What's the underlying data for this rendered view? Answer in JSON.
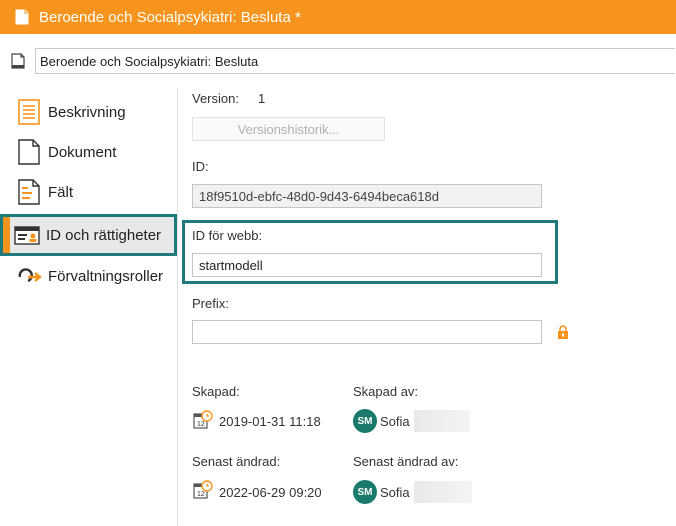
{
  "window": {
    "title": "Beroende och Socialpsykiatri: Besluta *"
  },
  "document": {
    "name": "Beroende och Socialpsykiatri: Besluta"
  },
  "sidebar": {
    "items": [
      {
        "label": "Beskrivning",
        "icon": "description-icon"
      },
      {
        "label": "Dokument",
        "icon": "document-icon"
      },
      {
        "label": "Fält",
        "icon": "fields-icon"
      },
      {
        "label": "ID och rättigheter",
        "icon": "id-card-icon",
        "active": true
      },
      {
        "label": "Förvaltningsroller",
        "icon": "roles-icon"
      }
    ]
  },
  "main": {
    "version_label": "Version:",
    "version_value": "1",
    "version_history_button": "Versionshistorik...",
    "id_label": "ID:",
    "id_value": "18f9510d-ebfc-48d0-9d43-6494beca618d",
    "web_id_label": "ID för webb:",
    "web_id_value": "startmodell",
    "prefix_label": "Prefix:",
    "prefix_value": "",
    "created_label": "Skapad:",
    "created_value": "2019-01-31 11:18",
    "created_by_label": "Skapad av:",
    "created_by_initials": "SM",
    "created_by_name": "Sofia",
    "modified_label": "Senast ändrad:",
    "modified_value": "2022-06-29 09:20",
    "modified_by_label": "Senast ändrad av:",
    "modified_by_initials": "SM",
    "modified_by_name": "Sofia"
  },
  "colors": {
    "accent": "#f7941d",
    "highlight": "#1f7b7b",
    "avatar": "#1a7a6c"
  }
}
